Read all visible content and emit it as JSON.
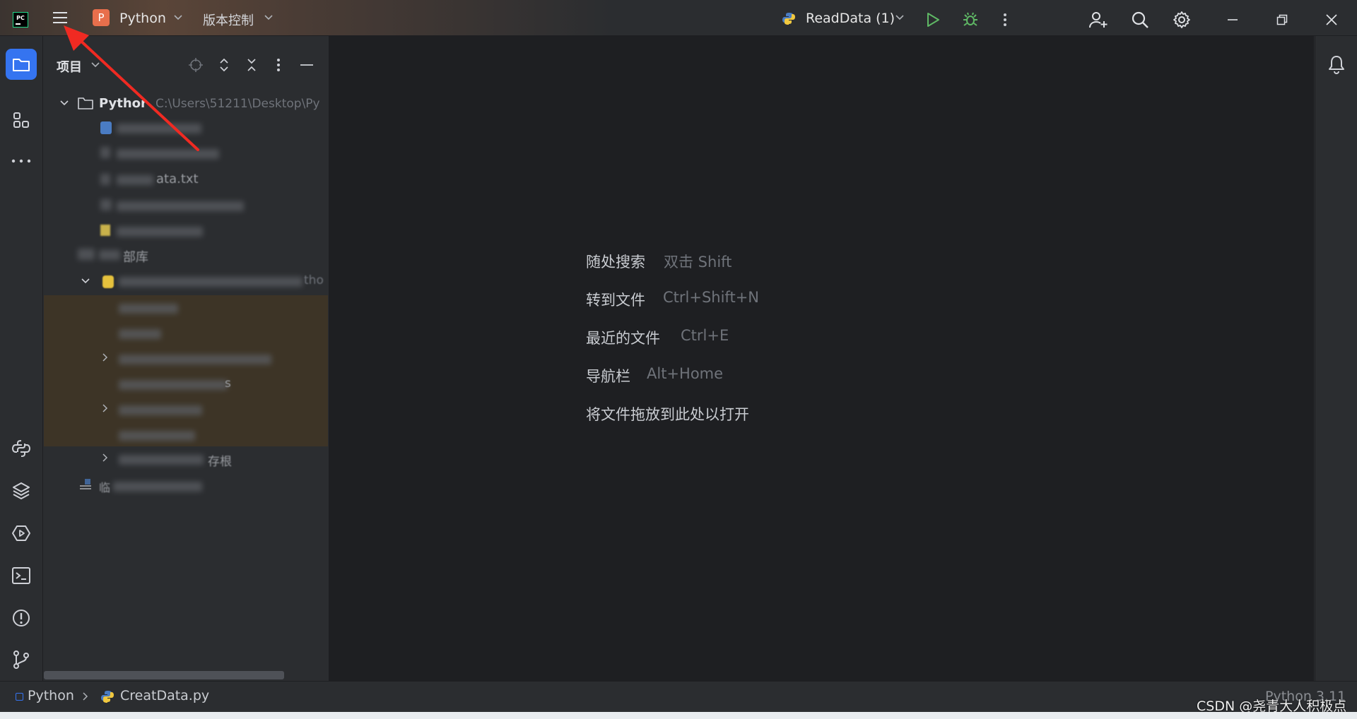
{
  "titlebar": {
    "project_letter": "P",
    "project_name": "Python",
    "vcs_label": "版本控制",
    "run_config": "ReadData (1)"
  },
  "project_panel": {
    "title": "项目",
    "root_name": "Pythor",
    "root_path": "C:\\Users\\51211\\Desktop\\Py",
    "file_fragment": "ata.txt",
    "ext_libs_fragment": "部库",
    "sdk_fragment": "tho",
    "item_fragment_s": "s",
    "item_fragment_lib": "存根",
    "scratch_fragment": "临"
  },
  "welcome": {
    "items": [
      {
        "label": "随处搜索",
        "shortcut": "双击 Shift"
      },
      {
        "label": "转到文件",
        "shortcut": "Ctrl+Shift+N"
      },
      {
        "label": "最近的文件",
        "shortcut": "Ctrl+E"
      },
      {
        "label": "导航栏",
        "shortcut": "Alt+Home"
      },
      {
        "label": "将文件拖放到此处以打开",
        "shortcut": ""
      }
    ]
  },
  "statusbar": {
    "crumb_project": "Python",
    "crumb_file": "CreatData.py",
    "interpreter": "Python 3.11",
    "watermark": "CSDN @尧青大人积极点"
  },
  "colors": {
    "accent": "#3574f0",
    "run_green": "#5fb865",
    "annotation_red": "#f02a22",
    "background": "#2b2d30",
    "highlight_row": "#3d3426"
  }
}
